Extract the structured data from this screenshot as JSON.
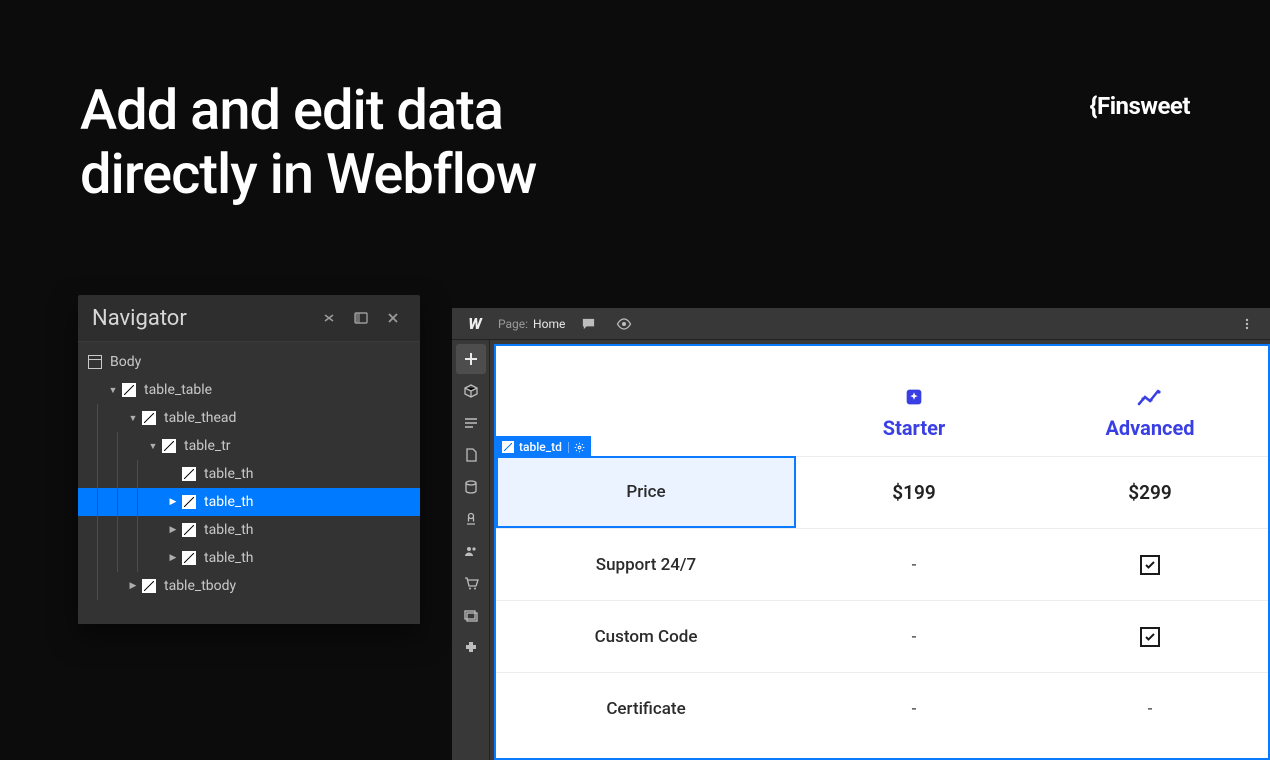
{
  "hero": {
    "line1": "Add and edit data",
    "line2": "directly in Webflow"
  },
  "brand": {
    "brace": "{",
    "name": "Finsweet"
  },
  "navigator": {
    "title": "Navigator",
    "body": "Body",
    "items": [
      {
        "label": "table_table",
        "indent": 1,
        "caret": "down"
      },
      {
        "label": "table_thead",
        "indent": 2,
        "caret": "down"
      },
      {
        "label": "table_tr",
        "indent": 3,
        "caret": "down"
      },
      {
        "label": "table_th",
        "indent": 4,
        "caret": "none"
      },
      {
        "label": "table_th",
        "indent": 4,
        "caret": "right",
        "selected": true
      },
      {
        "label": "table_th",
        "indent": 4,
        "caret": "right"
      },
      {
        "label": "table_th",
        "indent": 4,
        "caret": "right"
      },
      {
        "label": "table_tbody",
        "indent": 2,
        "caret": "right"
      }
    ]
  },
  "designer": {
    "page_label": "Page:",
    "page_name": "Home",
    "selected_tag": "table_td"
  },
  "pricing": {
    "plans": [
      {
        "name": "Starter"
      },
      {
        "name": "Advanced"
      }
    ],
    "rows": [
      {
        "label": "Price",
        "starter": "$199",
        "advanced": "$299",
        "selected": true
      },
      {
        "label": "Support 24/7",
        "starter": "-",
        "advanced": "check"
      },
      {
        "label": "Custom Code",
        "starter": "-",
        "advanced": "check"
      },
      {
        "label": "Certificate",
        "starter": "-",
        "advanced": "-"
      }
    ]
  }
}
